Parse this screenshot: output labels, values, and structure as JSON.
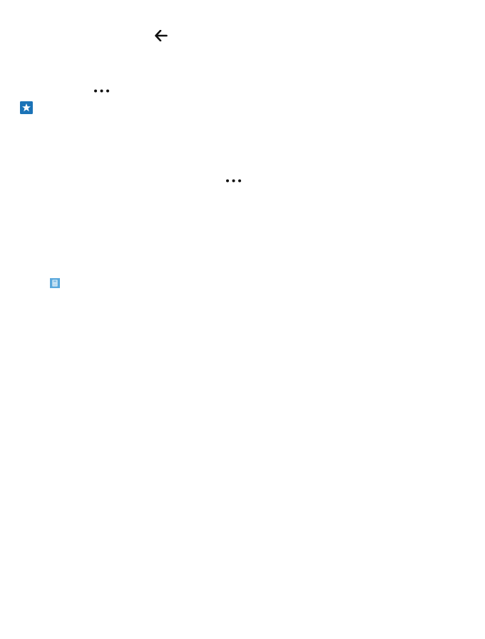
{
  "icons": {
    "back": "back-arrow-icon",
    "more_top": "more-ellipsis-icon",
    "favorite": "star-icon",
    "more_middle": "more-ellipsis-icon",
    "calculator": "calculator-icon"
  },
  "colors": {
    "background": "#ffffff",
    "glyph": "#111111",
    "favorite_tile": "#1b73b7",
    "calculator_tile": "#5aa8dc"
  }
}
